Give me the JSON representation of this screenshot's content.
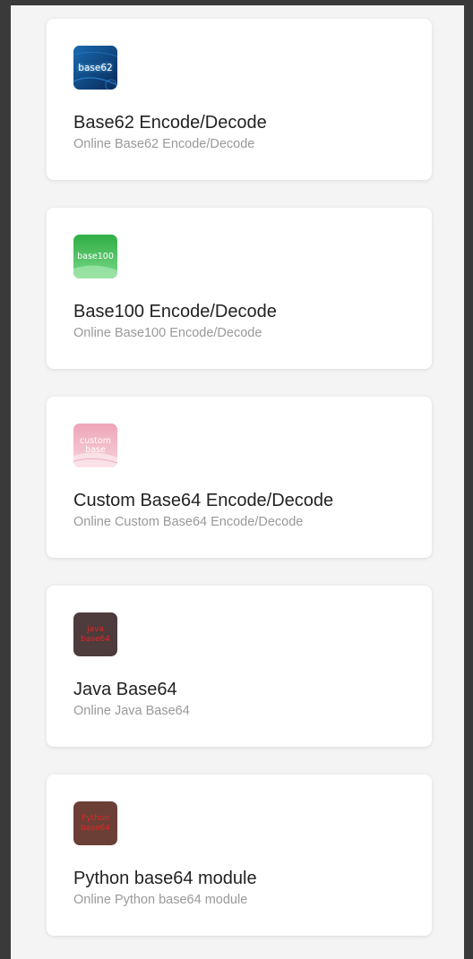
{
  "tools": [
    {
      "logo_text": "base62",
      "logo_icon": "base62-logo-icon",
      "title": "Base62 Encode/Decode",
      "description": "Online Base62 Encode/Decode"
    },
    {
      "logo_text": "base100",
      "logo_icon": "base100-logo-icon",
      "title": "Base100 Encode/Decode",
      "description": "Online Base100 Encode/Decode"
    },
    {
      "logo_text": "custom base",
      "logo_icon": "custom-base-logo-icon",
      "title": "Custom Base64 Encode/Decode",
      "description": "Online Custom Base64 Encode/Decode"
    },
    {
      "logo_text": "java base64",
      "logo_icon": "java-base64-logo-icon",
      "title": "Java Base64",
      "description": "Online Java Base64"
    },
    {
      "logo_text": "Python base64",
      "logo_icon": "python-base64-logo-icon",
      "title": "Python base64 module",
      "description": "Online Python base64 module"
    }
  ],
  "colors": {
    "page_background": "#f4f4f4",
    "outer_frame": "#3a3a3a",
    "card_background": "#ffffff",
    "title_text": "#222222",
    "description_text": "#999999",
    "base62_logo": "#0d4a8a",
    "base100_logo": "#3cbb4f",
    "custom_base_logo": "#f0b3c0",
    "java_logo": "#4e3b3b",
    "python_logo": "#6b3f35",
    "java_python_logo_text": "#e0262a"
  }
}
